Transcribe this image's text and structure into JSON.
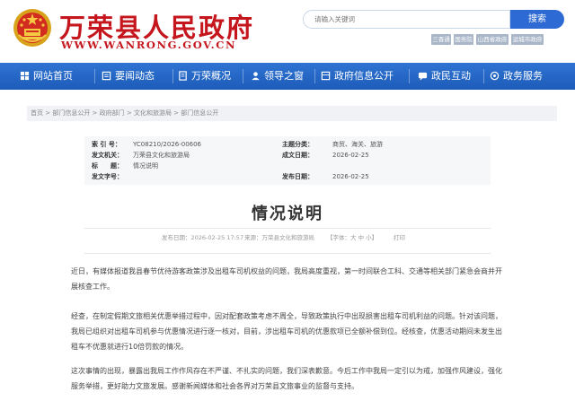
{
  "header": {
    "site_name": "万荣县人民政府",
    "site_domain": "WWW.WANRONG.GOV.CN",
    "search_placeholder": "请输入关键词",
    "search_button": "搜索",
    "hot_words": [
      "三晋通",
      "国务院",
      "山西省政府",
      "运城市政府"
    ]
  },
  "nav": {
    "items": [
      {
        "label": "网站首页",
        "icon": "home-icon"
      },
      {
        "label": "要闻动态",
        "icon": "news-icon"
      },
      {
        "label": "万荣概况",
        "icon": "overview-icon"
      },
      {
        "label": "领导之窗",
        "icon": "leader-icon"
      },
      {
        "label": "政府信息公开",
        "icon": "info-open-icon"
      },
      {
        "label": "政民互动",
        "icon": "interaction-icon"
      },
      {
        "label": "政务服务",
        "icon": "service-icon"
      }
    ]
  },
  "breadcrumb": "首页 > 部门信息公开 > 政府部门 > 文化和旅游局 > 部门信息公开",
  "meta": {
    "index_label": "索 引 号：",
    "index_value": "YC08210/2026-00606",
    "org_label": "发文机关：",
    "org_value": "万荣县文化和旅游局",
    "title_label": "标　　题：",
    "title_value": "情况说明",
    "docno_label": "发文字号：",
    "docno_value": "",
    "pubdate_label": "发布日期：",
    "pubdate_value": "2026-02-25",
    "topic_label": "主题分类：",
    "topic_value": "商贸、海关、旅游",
    "created_label": "成文日期：",
    "created_value": "2026-02-25"
  },
  "doc": {
    "title": "情况说明",
    "date_text": "发布日期：2026-02-25 17:57",
    "source_text": "来源：万荣县文化和旅游局",
    "font_size_text": "【字体：大 中 小】",
    "print_text": "打印",
    "paragraphs": [
      "近日，有媒体报道我县春节优待游客政策涉及出租车司机权益的问题，我局高度重视，第一时间联合工科、交通等相关部门紧急会商并开展核查工作。",
      "经查，在制定假期文旅相关优惠举措过程中，因对配套政策考虑不周全，导致政策执行中出现损害出租车司机利益的问题。针对该问题，我局已组织对出租车司机参与优惠情况进行逐一核对，目前，涉出租车司机的优惠款项已全额补偿到位。经核查，优惠活动期间未发生出租车不优惠就进行10倍罚款的情况。",
      "这次事情的出现，暴露出我局工作作风存在不严谨、不扎实的问题，我们深表歉意。今后工作中我局一定引以为戒，加强作风建设，强化服务举措，更好助力文旅发展。感谢新闻媒体和社会各界对万荣县文旅事业的监督与支持。"
    ]
  },
  "colors": {
    "brand_red": "#c5161d",
    "nav_blue": "#2f74d3",
    "search_blue": "#2d6ad4"
  }
}
